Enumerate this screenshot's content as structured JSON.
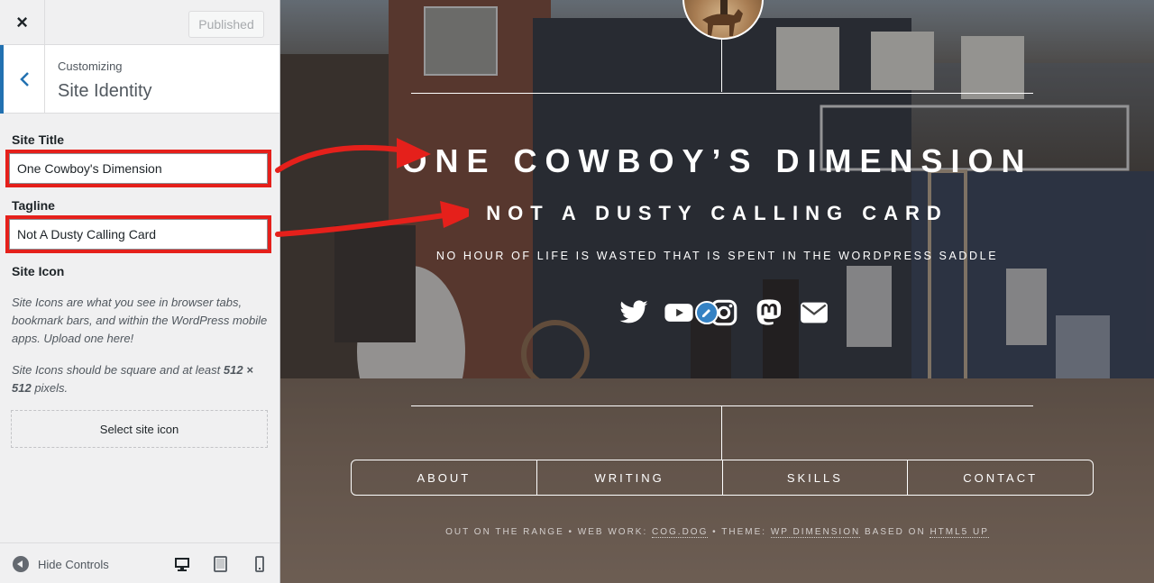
{
  "customizer": {
    "close_label": "×",
    "publish_label": "Published",
    "breadcrumb": "Customizing",
    "section_title": "Site Identity",
    "site_title_label": "Site Title",
    "site_title_value": "One Cowboy's Dimension",
    "tagline_label": "Tagline",
    "tagline_value": "Not A Dusty Calling Card",
    "site_icon_label": "Site Icon",
    "site_icon_desc_1": "Site Icons are what you see in browser tabs, bookmark bars, and within the WordPress mobile apps. Upload one here!",
    "site_icon_desc_2_pre": "Site Icons should be square and at least ",
    "site_icon_desc_2_bold": "512 × 512",
    "site_icon_desc_2_post": " pixels.",
    "select_icon_label": "Select site icon",
    "hide_controls_label": "Hide Controls"
  },
  "preview": {
    "title": "ONE COWBOY’S DIMENSION",
    "tagline": "NOT A DUSTY CALLING CARD",
    "quote": "NO HOUR OF LIFE IS WASTED THAT IS SPENT IN THE WORDPRESS SADDLE",
    "nav": [
      "ABOUT",
      "WRITING",
      "SKILLS",
      "CONTACT"
    ],
    "credits_1": "OUT ON THE RANGE • WEB WORK: ",
    "credits_link_1": "COG.DOG",
    "credits_2": " • THEME: ",
    "credits_link_2": "WP DIMENSION",
    "credits_3": " BASED ON ",
    "credits_link_3": "HTML5 UP",
    "social_icons": [
      "twitter-icon",
      "youtube-icon",
      "instagram-icon",
      "mastodon-icon",
      "email-icon"
    ]
  },
  "colors": {
    "annotation_red": "#e5201b",
    "wp_blue": "#2271b1"
  }
}
